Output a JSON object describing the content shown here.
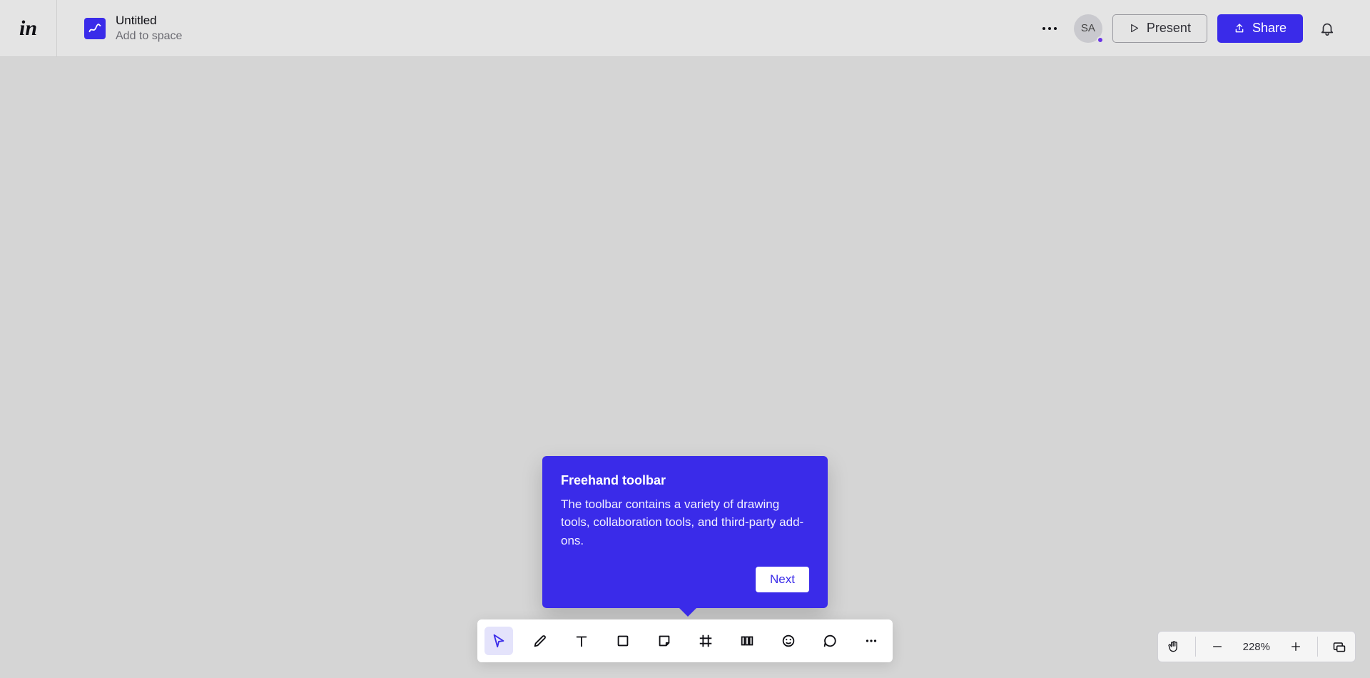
{
  "header": {
    "document_title": "Untitled",
    "document_subtitle": "Add to space",
    "avatar_initials": "SA",
    "present_label": "Present",
    "share_label": "Share"
  },
  "popover": {
    "title": "Freehand toolbar",
    "body": "The toolbar contains a variety of drawing tools, collaboration tools, and third-party add-ons.",
    "next_label": "Next"
  },
  "toolbar": {
    "tools": [
      {
        "name": "pointer-tool",
        "icon": "pointer",
        "active": true
      },
      {
        "name": "pencil-tool",
        "icon": "pencil",
        "active": false
      },
      {
        "name": "text-tool",
        "icon": "text",
        "active": false
      },
      {
        "name": "shape-tool",
        "icon": "rect",
        "active": false
      },
      {
        "name": "sticky-tool",
        "icon": "note",
        "active": false
      },
      {
        "name": "frame-tool",
        "icon": "frame",
        "active": false
      },
      {
        "name": "align-tool",
        "icon": "columns",
        "active": false
      },
      {
        "name": "sticker-tool",
        "icon": "emoji",
        "active": false
      },
      {
        "name": "comment-tool",
        "icon": "comment",
        "active": false
      },
      {
        "name": "more-tool",
        "icon": "dots",
        "active": false
      }
    ]
  },
  "zoom": {
    "percent_label": "228%"
  }
}
